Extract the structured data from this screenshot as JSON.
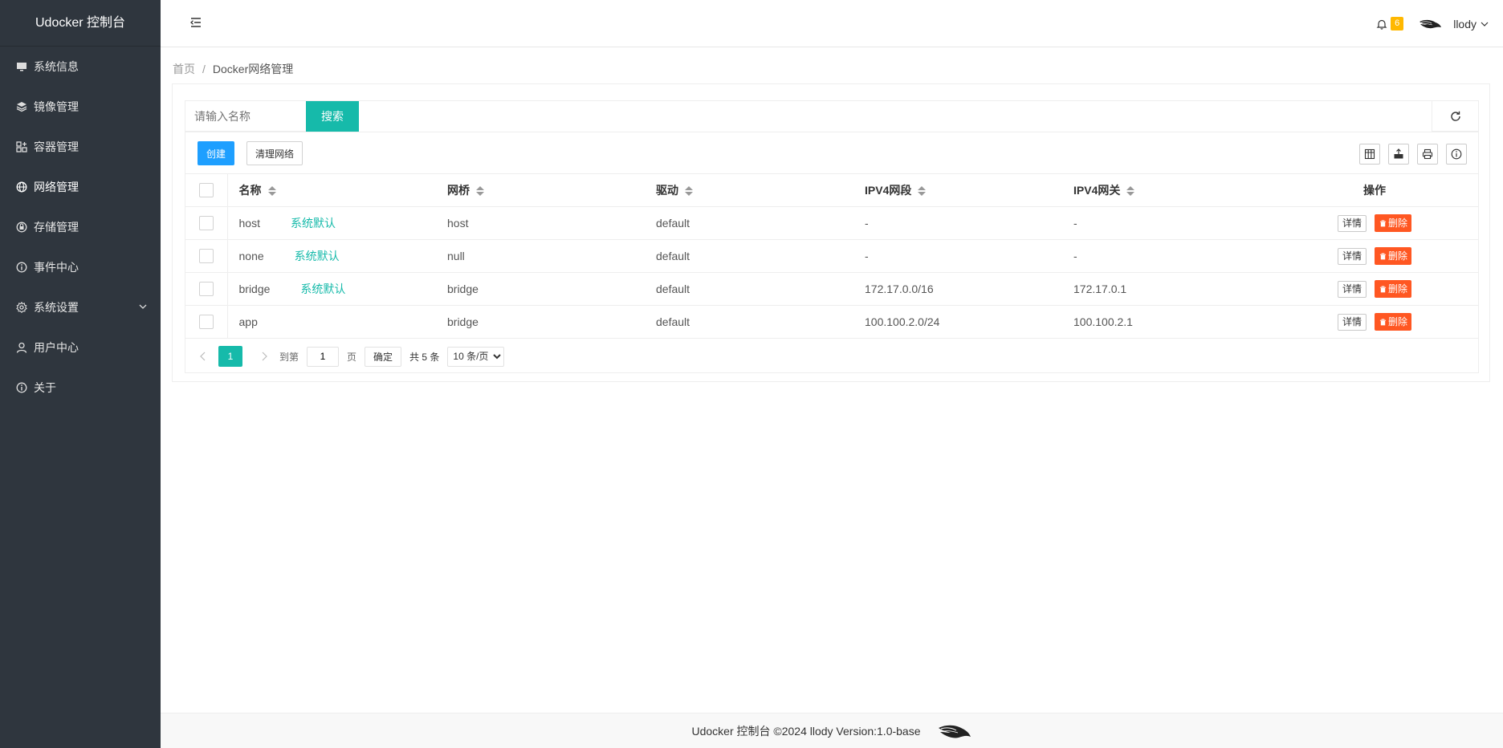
{
  "app": {
    "title": "Udocker 控制台"
  },
  "sidebar": {
    "items": [
      {
        "label": "系统信息",
        "icon": "monitor-icon"
      },
      {
        "label": "镜像管理",
        "icon": "layers-icon"
      },
      {
        "label": "容器管理",
        "icon": "app-grid-icon"
      },
      {
        "label": "网络管理",
        "icon": "globe-icon",
        "active": true
      },
      {
        "label": "存储管理",
        "icon": "storage-icon"
      },
      {
        "label": "事件中心",
        "icon": "info-icon"
      },
      {
        "label": "系统设置",
        "icon": "gear-icon",
        "expandable": true
      },
      {
        "label": "用户中心",
        "icon": "user-icon"
      },
      {
        "label": "关于",
        "icon": "info-icon"
      }
    ]
  },
  "header": {
    "notification_count": "6",
    "username": "llody"
  },
  "breadcrumb": {
    "home": "首页",
    "separator": "/",
    "current": "Docker网络管理"
  },
  "search": {
    "placeholder": "请输入名称",
    "button": "搜索"
  },
  "toolbar": {
    "create": "创建",
    "clean": "清理网络"
  },
  "table": {
    "headers": {
      "name": "名称",
      "bridge": "网桥",
      "driver": "驱动",
      "subnet": "IPV4网段",
      "gateway": "IPV4网关",
      "ops": "操作"
    },
    "detail_label": "详情",
    "delete_label": "删除",
    "rows": [
      {
        "name": "host",
        "tag": "系统默认",
        "bridge": "host",
        "driver": "default",
        "subnet": "-",
        "gateway": "-"
      },
      {
        "name": "none",
        "tag": "系统默认",
        "bridge": "null",
        "driver": "default",
        "subnet": "-",
        "gateway": "-"
      },
      {
        "name": "bridge",
        "tag": "系统默认",
        "bridge": "bridge",
        "driver": "default",
        "subnet": "172.17.0.0/16",
        "gateway": "172.17.0.1"
      },
      {
        "name": "app",
        "tag": "",
        "bridge": "bridge",
        "driver": "default",
        "subnet": "100.100.2.0/24",
        "gateway": "100.100.2.1"
      }
    ]
  },
  "pagination": {
    "current_page": "1",
    "goto_label": "到第",
    "goto_value": "1",
    "page_unit": "页",
    "confirm": "确定",
    "total": "共 5 条",
    "page_size": "10 条/页"
  },
  "footer": {
    "text": "Udocker 控制台 ©2024 llody Version:1.0-base"
  },
  "colors": {
    "sidebar_bg": "#2f363e",
    "primary": "#16baaa",
    "blue": "#1e9fff",
    "danger": "#ff5722",
    "badge": "#ffb800"
  }
}
